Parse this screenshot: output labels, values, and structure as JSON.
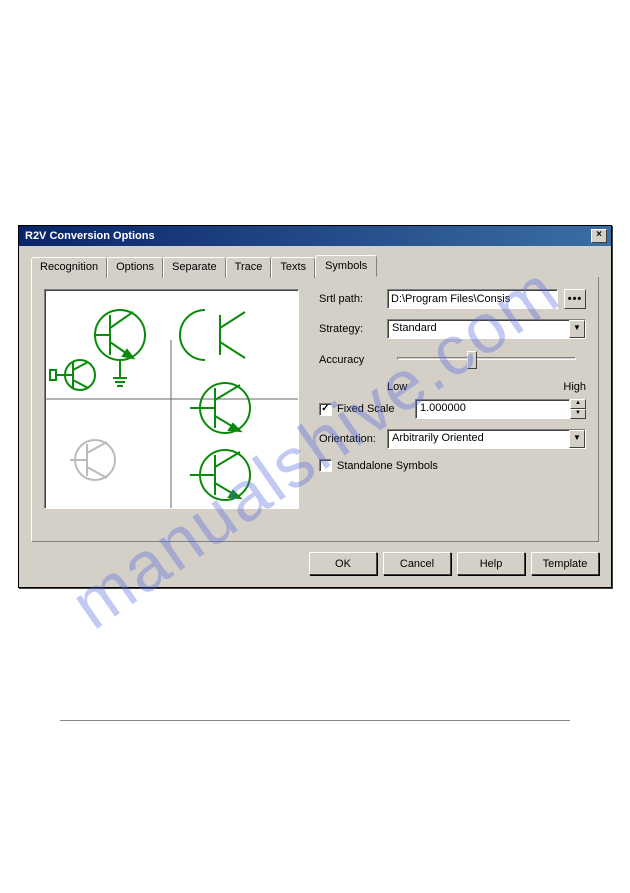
{
  "watermark": "manualshive.com",
  "dialog": {
    "title": "R2V Conversion Options",
    "close": "×"
  },
  "tabs": [
    "Recognition",
    "Options",
    "Separate",
    "Trace",
    "Texts",
    "Symbols"
  ],
  "active_tab": 5,
  "fields": {
    "srtl_label": "Srtl path:",
    "srtl_value": "D:\\Program Files\\Consis",
    "browse": "•••",
    "strategy_label": "Strategy:",
    "strategy_value": "Standard",
    "accuracy_label": "Accuracy",
    "accuracy_low": "Low",
    "accuracy_high": "High",
    "fixed_scale_label": "Fixed Scale",
    "fixed_scale_checked": true,
    "fixed_scale_value": "1.000000",
    "orientation_label": "Orientation:",
    "orientation_value": "Arbitrarily Oriented",
    "standalone_label": "Standalone Symbols",
    "standalone_checked": false
  },
  "buttons": {
    "ok": "OK",
    "cancel": "Cancel",
    "help": "Help",
    "template": "Template"
  }
}
